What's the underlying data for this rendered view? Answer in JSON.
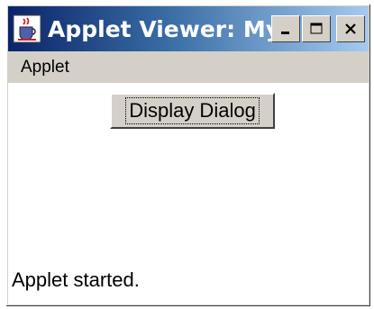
{
  "window": {
    "title": "Applet Viewer: Mybu...",
    "icon": "java-cup-icon",
    "controls": {
      "minimize_icon": "minimize-icon",
      "maximize_icon": "maximize-icon",
      "close_icon": "close-icon"
    }
  },
  "menubar": {
    "items": [
      {
        "label": "Applet"
      }
    ]
  },
  "content": {
    "button_label": "Display Dialog",
    "status_text": "Applet started."
  },
  "colors": {
    "titlebar_start": "#0a246a",
    "titlebar_end": "#a6caf0",
    "chrome": "#d4d0c8",
    "content_bg": "#ffffff"
  }
}
